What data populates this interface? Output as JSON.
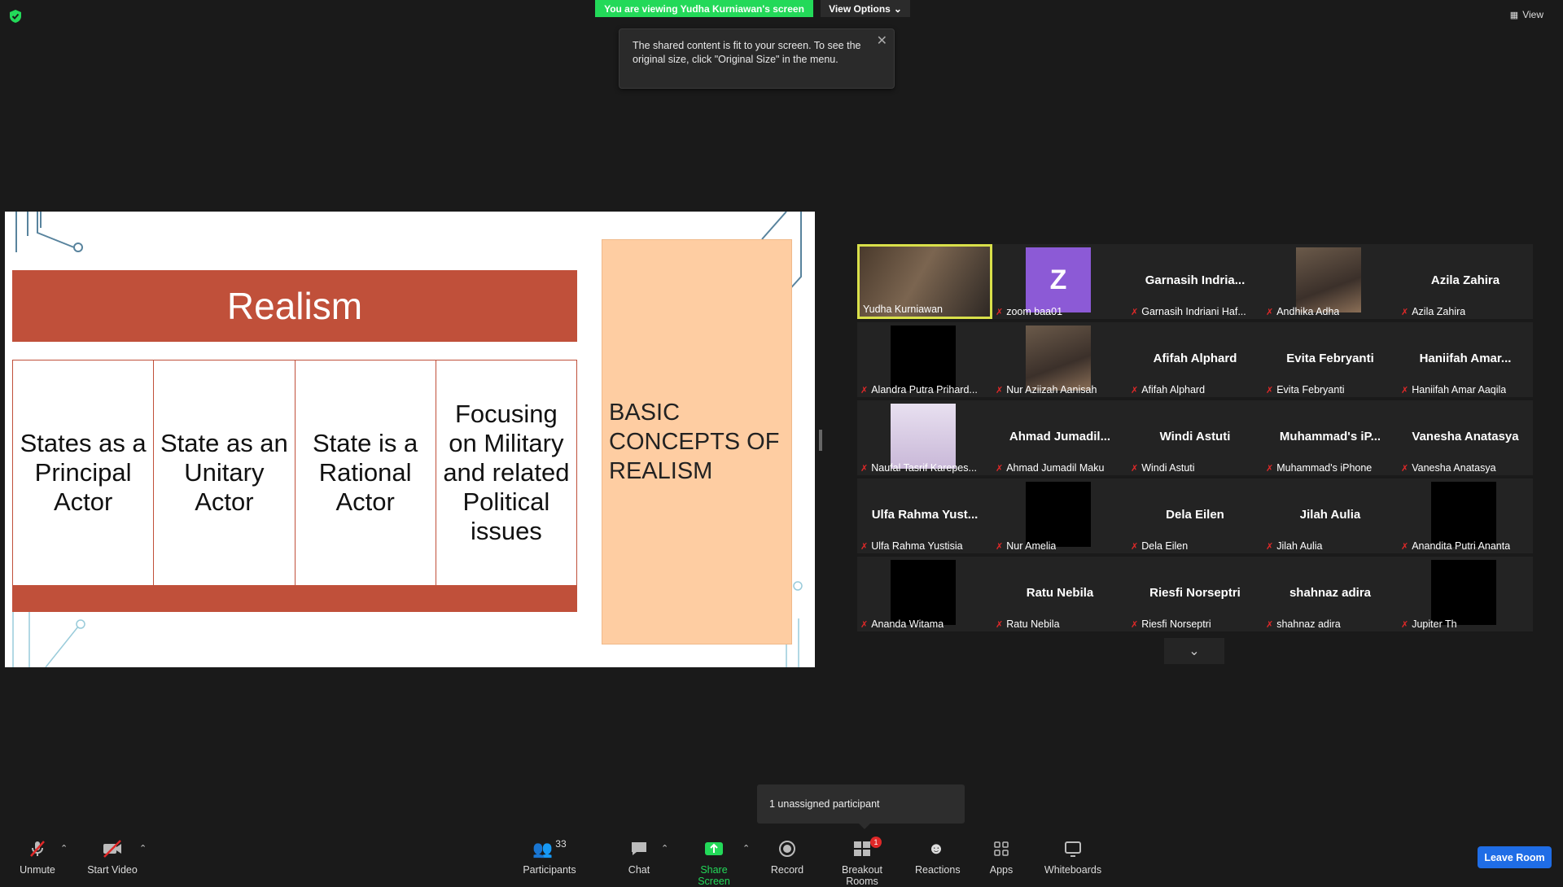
{
  "top": {
    "banner": "You are viewing Yudha Kurniawan's screen",
    "view_options": "View Options",
    "view": "View",
    "tooltip": "The shared content is fit to your screen. To see the original size, click \"Original Size\" in the menu."
  },
  "slide": {
    "title": "Realism",
    "columns": [
      "States as a Principal Actor",
      "State as an Unitary Actor",
      "State is a Rational Actor",
      "Focusing on Military and related Political issues"
    ],
    "side_box": "BASIC CONCEPTS OF REALISM"
  },
  "gallery": {
    "rows": [
      [
        {
          "name": "",
          "label": "Yudha Kurniawan",
          "video": "video",
          "muted": false
        },
        {
          "name": "",
          "label": "zoom baa01",
          "video": "avatar-z",
          "muted": true
        },
        {
          "name": "Garnasih  Indria...",
          "label": "Garnasih Indriani Haf...",
          "video": "none",
          "muted": true
        },
        {
          "name": "",
          "label": "Andhika Adha",
          "video": "photo",
          "muted": true
        },
        {
          "name": "Azila Zahira",
          "label": "Azila Zahira",
          "video": "none",
          "muted": true
        }
      ],
      [
        {
          "name": "",
          "label": "Alandra Putra Prihard...",
          "video": "black",
          "muted": true
        },
        {
          "name": "",
          "label": "Nur Aziizah Aanisah",
          "video": "photo",
          "muted": true
        },
        {
          "name": "Afifah Alphard",
          "label": "Afifah Alphard",
          "video": "none",
          "muted": true
        },
        {
          "name": "Evita Febryanti",
          "label": "Evita Febryanti",
          "video": "none",
          "muted": true
        },
        {
          "name": "Haniifah  Amar...",
          "label": "Haniifah Amar Aaqila",
          "video": "none",
          "muted": true
        }
      ],
      [
        {
          "name": "",
          "label": "Naufal Tasrif Karepes...",
          "video": "photo-cat",
          "muted": true
        },
        {
          "name": "Ahmad  Jumadil...",
          "label": "Ahmad Jumadil Maku",
          "video": "none",
          "muted": true
        },
        {
          "name": "Windi Astuti",
          "label": "Windi Astuti",
          "video": "none",
          "muted": true
        },
        {
          "name": "Muhammad's  iP...",
          "label": "Muhammad's iPhone",
          "video": "none",
          "muted": true
        },
        {
          "name": "Vanesha Anatasya",
          "label": "Vanesha Anatasya",
          "video": "none",
          "muted": true
        }
      ],
      [
        {
          "name": "Ulfa Rahma Yust...",
          "label": "Ulfa Rahma Yustisia",
          "video": "none",
          "muted": true
        },
        {
          "name": "",
          "label": "Nur Amelia",
          "video": "black",
          "muted": true
        },
        {
          "name": "Dela Eilen",
          "label": "Dela Eilen",
          "video": "none",
          "muted": true
        },
        {
          "name": "Jilah Aulia",
          "label": "Jilah Aulia",
          "video": "none",
          "muted": true
        },
        {
          "name": "",
          "label": "Anandita Putri Ananta",
          "video": "black",
          "muted": true
        }
      ],
      [
        {
          "name": "",
          "label": "Ananda Witama",
          "video": "black",
          "muted": true
        },
        {
          "name": "Ratu Nebila",
          "label": "Ratu Nebila",
          "video": "none",
          "muted": true
        },
        {
          "name": "Riesfi Norseptri",
          "label": "Riesfi Norseptri",
          "video": "none",
          "muted": true
        },
        {
          "name": "shahnaz adira",
          "label": "shahnaz adira",
          "video": "none",
          "muted": true
        },
        {
          "name": "",
          "label": "Jupiter Th",
          "video": "black",
          "muted": true
        }
      ]
    ]
  },
  "popover": "1 unassigned participant",
  "toolbar": {
    "unmute": "Unmute",
    "start_video": "Start Video",
    "participants": "Participants",
    "participants_count": "33",
    "chat": "Chat",
    "share_screen": "Share Screen",
    "record": "Record",
    "breakout_rooms": "Breakout Rooms",
    "breakout_badge": "1",
    "reactions": "Reactions",
    "apps": "Apps",
    "whiteboards": "Whiteboards",
    "leave": "Leave Room"
  },
  "colors": {
    "banner": "#23d959",
    "slide_accent": "#c0503a",
    "side_box": "#fecda2",
    "leave": "#1f6de6",
    "active_speaker": "#d9e04a"
  }
}
